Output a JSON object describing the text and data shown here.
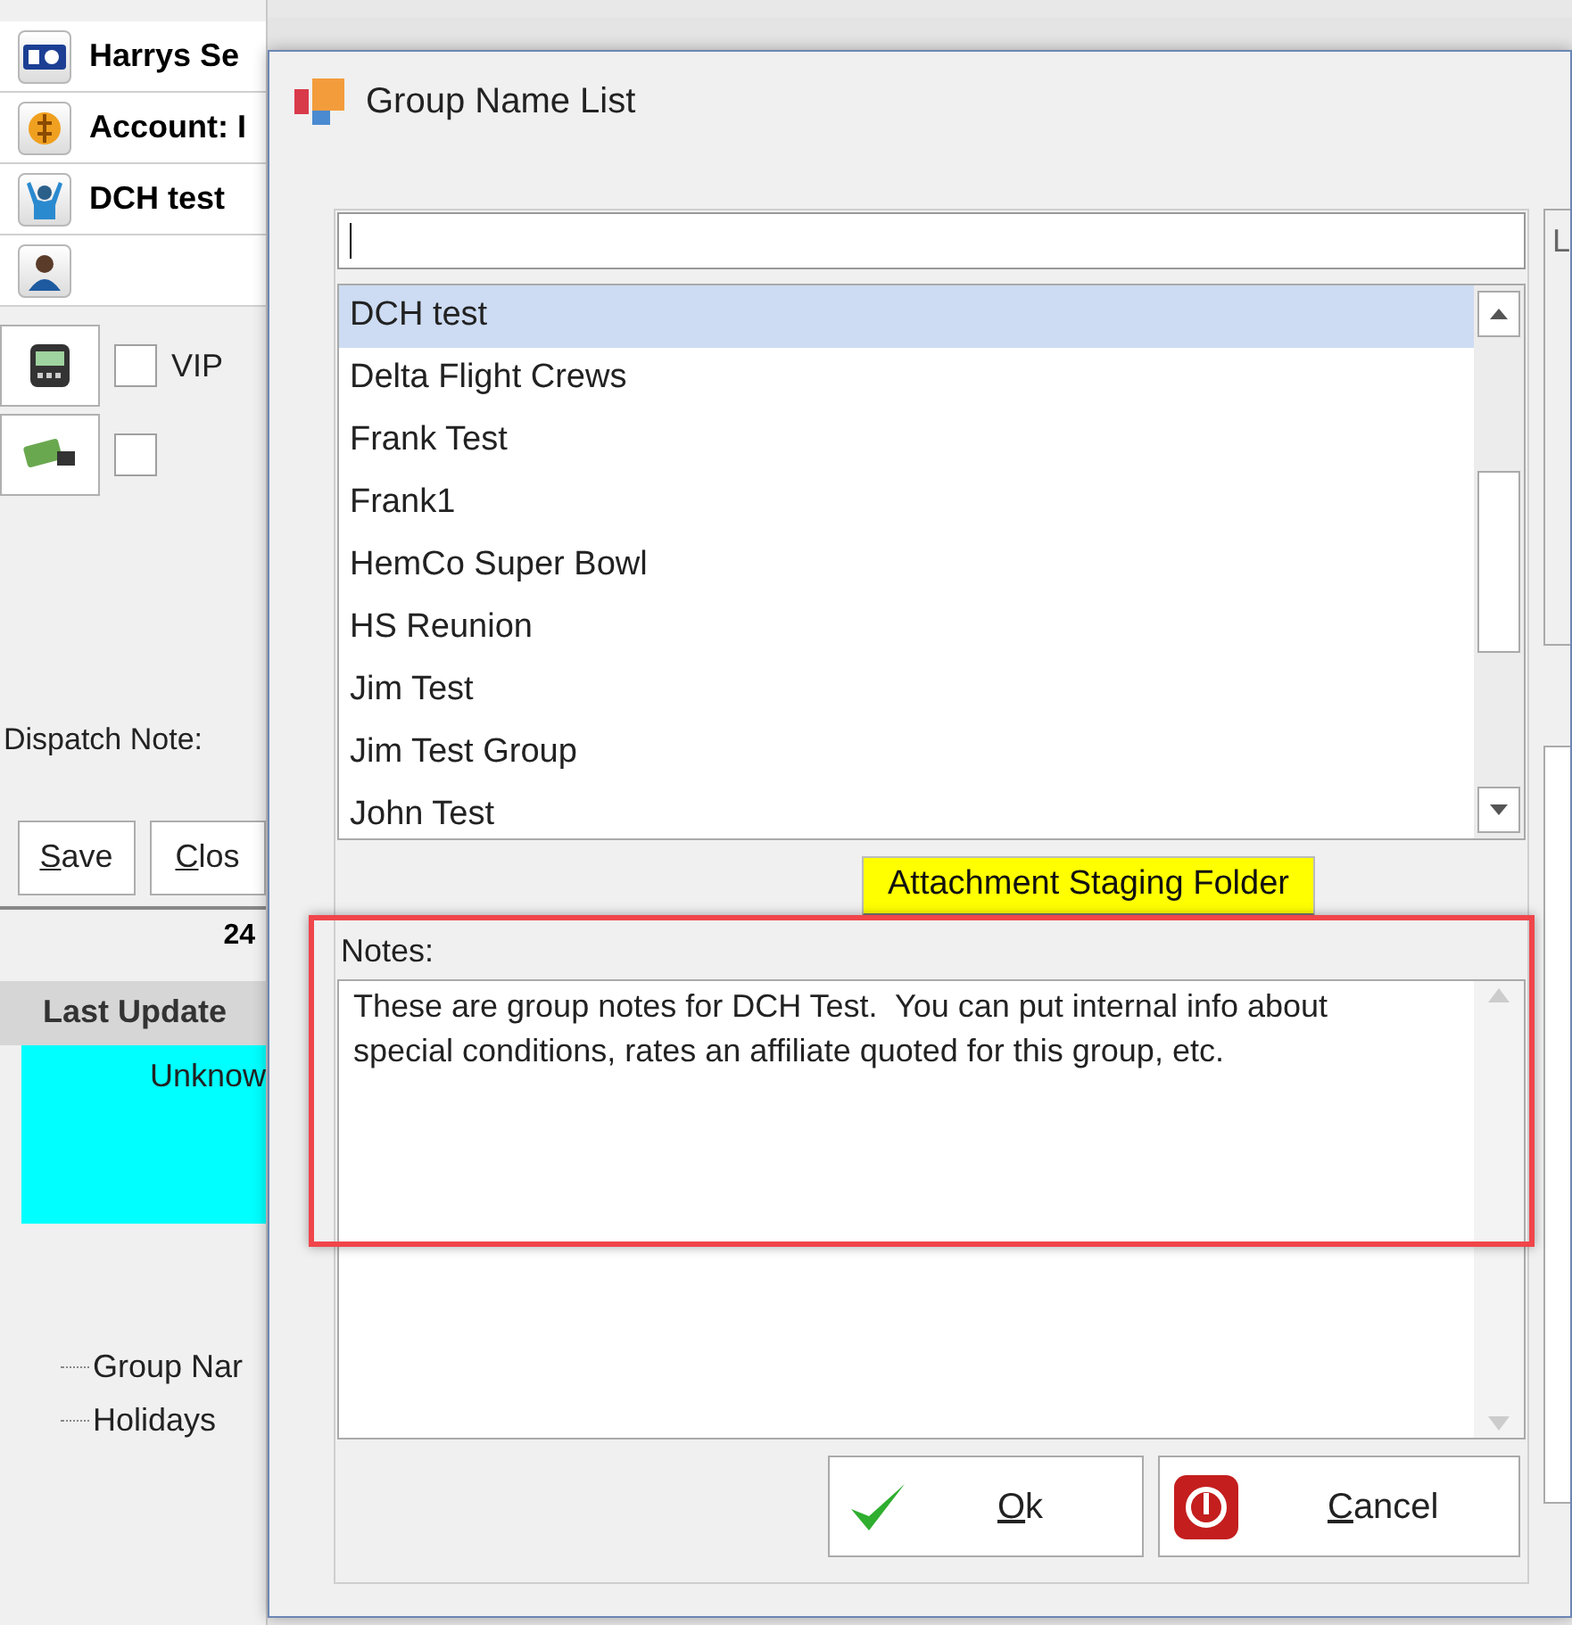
{
  "background": {
    "header_rows": [
      {
        "text": "Harrys Se"
      },
      {
        "text": "Account: I"
      },
      {
        "text": "DCH test"
      },
      {}
    ],
    "checks": [
      {
        "label": "VIP",
        "checked": false
      },
      {
        "checked": false
      }
    ],
    "dispatch_note_label": "Dispatch Note:",
    "buttons": [
      "Save",
      "Clos"
    ],
    "count": "24",
    "last_update_header": "Last Update",
    "status_cell": "Unknow",
    "tree": [
      "Group Nar",
      "Holidays"
    ]
  },
  "dialog": {
    "title": "Group Name List",
    "groups": [
      {
        "name": "DCH test",
        "selected": true
      },
      {
        "name": "Delta Flight Crews",
        "selected": false
      },
      {
        "name": "Frank Test",
        "selected": false
      },
      {
        "name": "Frank1",
        "selected": false
      },
      {
        "name": "HemCo Super Bowl",
        "selected": false
      },
      {
        "name": "HS Reunion",
        "selected": false
      },
      {
        "name": "Jim Test",
        "selected": false
      },
      {
        "name": "Jim Test Group",
        "selected": false
      },
      {
        "name": "John Test",
        "selected": false
      }
    ],
    "attachment_button": "Attachment Staging Folder",
    "notes_label": "Notes:",
    "notes": "These are group notes for DCH Test.  You can put internal info about special conditions, rates an affiliate quoted for this group, etc.",
    "ok_button": "Ok",
    "cancel_button": "Cancel",
    "side_label": "L"
  }
}
